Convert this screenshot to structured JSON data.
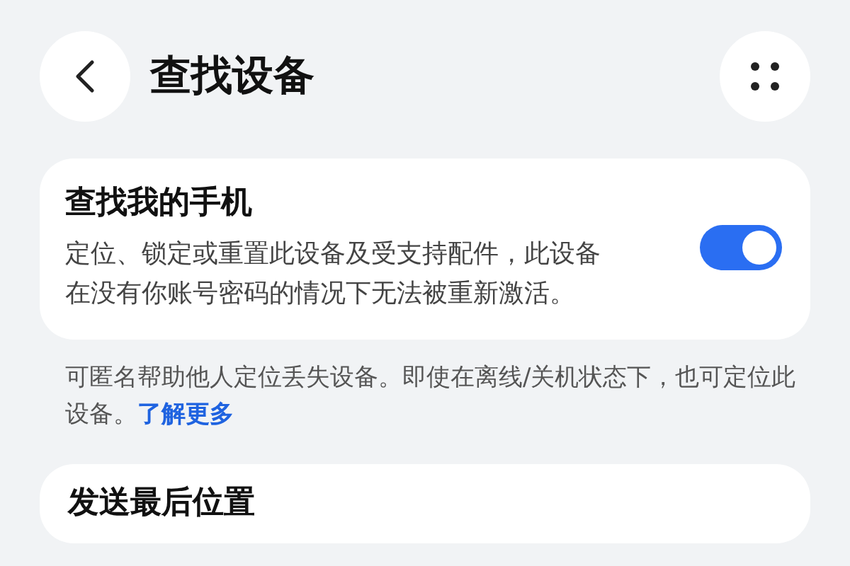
{
  "header": {
    "title": "查找设备"
  },
  "find_phone": {
    "title": "查找我的手机",
    "description": "定位、锁定或重置此设备及受支持配件，此设备在没有你账号密码的情况下无法被重新激活。",
    "on": true
  },
  "note": {
    "text": "可匿名帮助他人定位丢失设备。即使在离线/关机状态下，也可定位此设备。",
    "link": "了解更多"
  },
  "last_location": {
    "title": "发送最后位置"
  }
}
